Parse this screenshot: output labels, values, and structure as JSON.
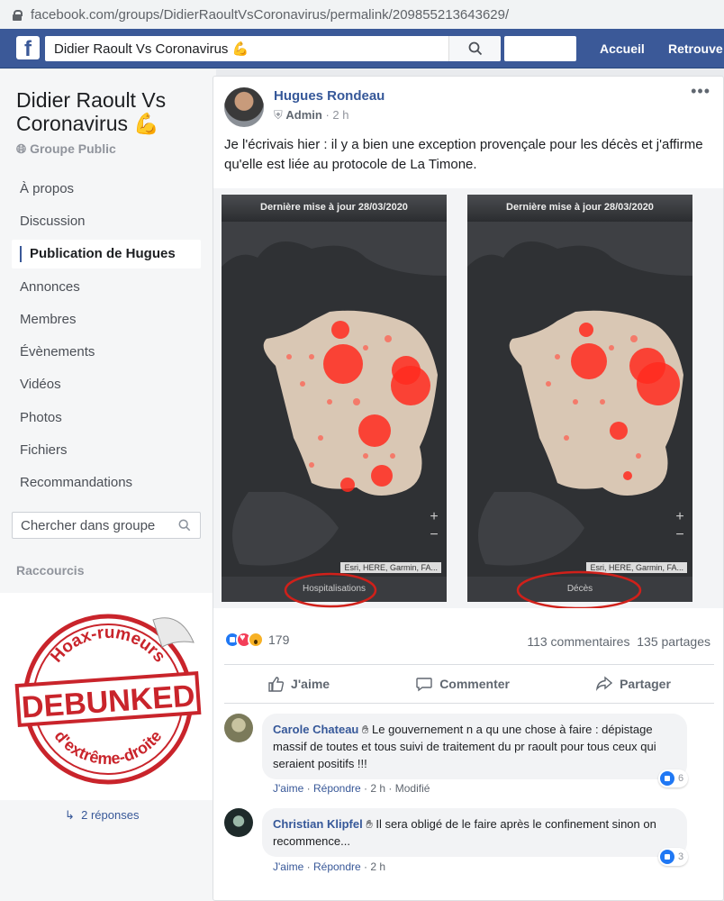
{
  "browser": {
    "url": "facebook.com/groups/DidierRaoultVsCoronavirus/permalink/209855213643629/"
  },
  "header": {
    "search_value": "Didier Raoult Vs Coronavirus 💪",
    "nav": [
      "Accueil",
      "Retrouve"
    ]
  },
  "sidebar": {
    "group_name": "Didier Raoult Vs Coronavirus 💪",
    "group_type": "Groupe Public",
    "items": [
      {
        "label": "À propos"
      },
      {
        "label": "Discussion"
      },
      {
        "label": "Publication de Hugues",
        "active": true
      },
      {
        "label": "Annonces"
      },
      {
        "label": "Membres"
      },
      {
        "label": "Évènements"
      },
      {
        "label": "Vidéos"
      },
      {
        "label": "Photos"
      },
      {
        "label": "Fichiers"
      },
      {
        "label": "Recommandations"
      }
    ],
    "search_placeholder": "Chercher dans groupe",
    "shortcuts_label": "Raccourcis"
  },
  "stamp": {
    "top_text": "Hoax-rumeurs",
    "main_text": "DEBUNKED",
    "bottom_text": "d'extrême-droite"
  },
  "post": {
    "author": "Hugues Rondeau",
    "role": "Admin",
    "time": "2 h",
    "text": "Je l'écrivais hier : il y a bien une exception provençale pour les décès et j'affirme qu'elle est liée au protocole de La Timone.",
    "maps": [
      {
        "title": "Dernière mise à jour 28/03/2020",
        "footer": "Hospitalisations",
        "attribution": "Esri, HERE, Garmin, FA..."
      },
      {
        "title": "Dernière mise à jour 28/03/2020",
        "footer": "Décès",
        "attribution": "Esri, HERE, Garmin, FA..."
      }
    ],
    "reactions_count": "179",
    "comments_count": "113 commentaires",
    "shares_count": "135 partages",
    "actions": {
      "like": "J'aime",
      "comment": "Commenter",
      "share": "Partager"
    }
  },
  "comments": [
    {
      "author": "Carole Chateau",
      "text": "Le gouvernement n a qu une chose à faire : dépistage massif de toutes et tous suivi de traitement du pr raoult pour tous ceux qui seraient positifs !!!",
      "like": "J'aime",
      "reply": "Répondre",
      "time": "2 h",
      "edited": "Modifié",
      "likes": "6"
    },
    {
      "author": "Christian Klipfel",
      "text": "Il sera obligé de le faire après le confinement sinon on recommence...",
      "like": "J'aime",
      "reply": "Répondre",
      "time": "2 h",
      "likes": "3"
    }
  ],
  "replies_link": "2 réponses"
}
